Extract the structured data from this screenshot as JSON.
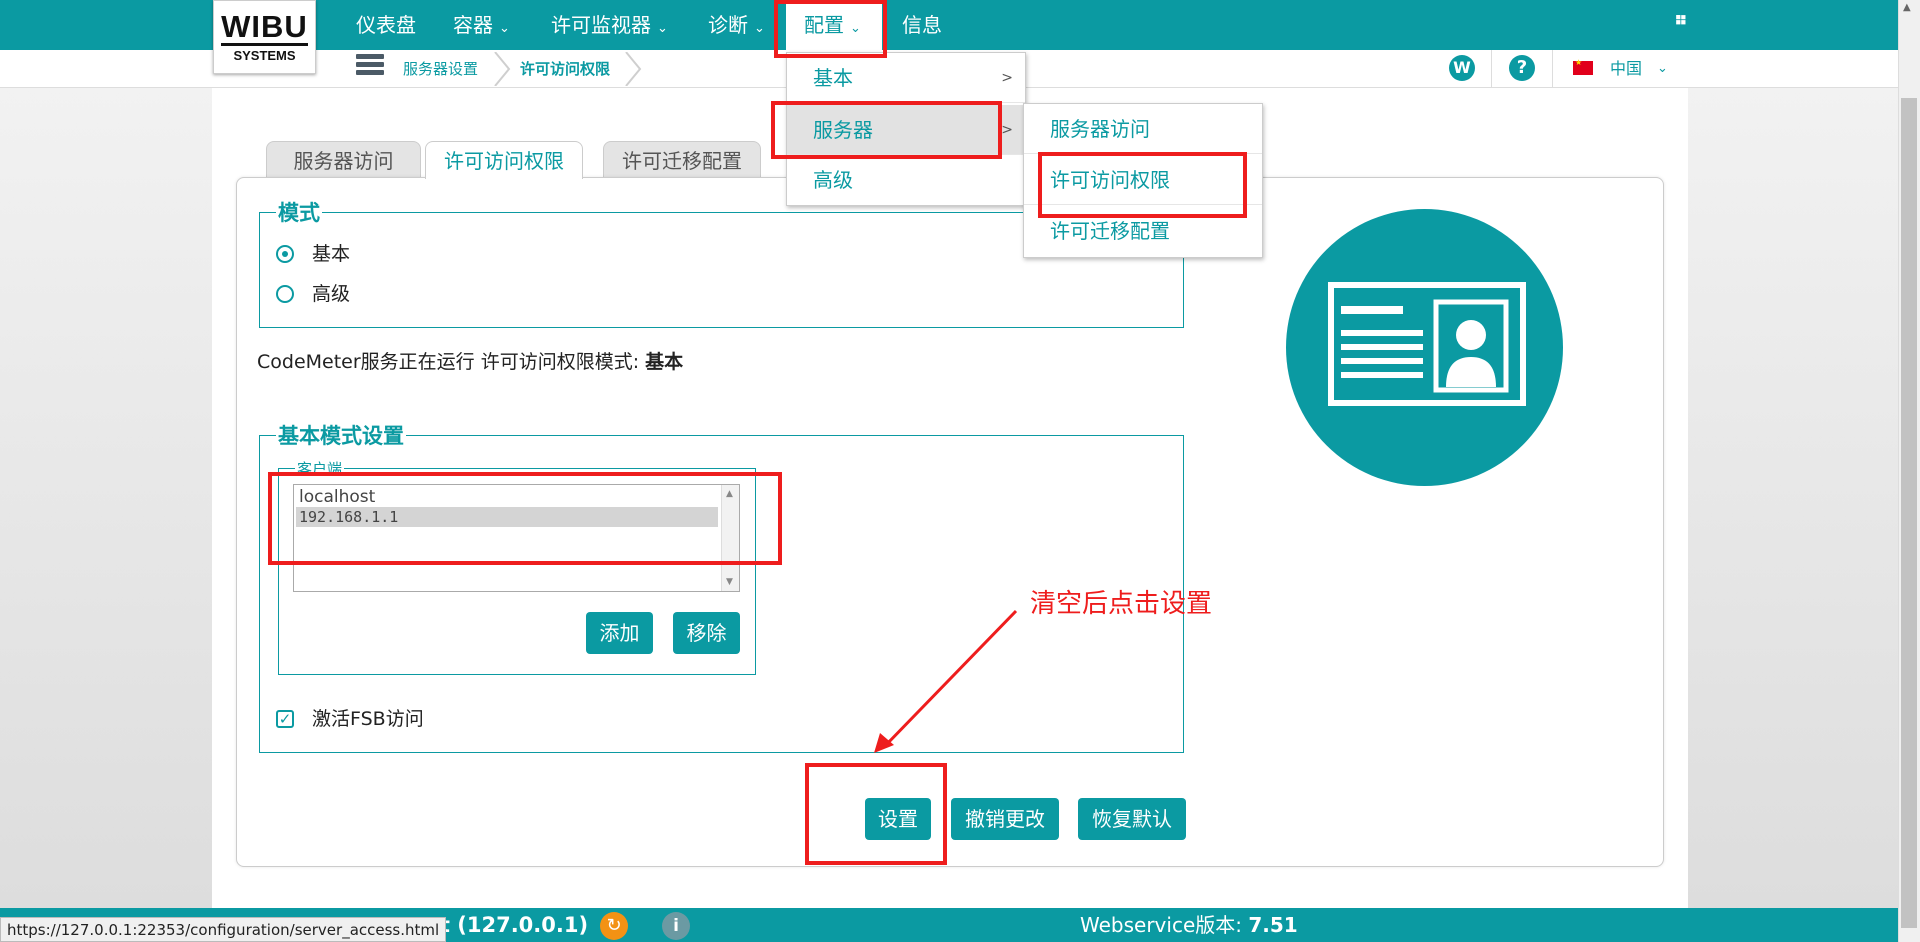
{
  "nav": {
    "logo_top": "WIBU",
    "logo_bottom": "SYSTEMS",
    "items": [
      "仪表盘",
      "容器",
      "许可监视器",
      "诊断",
      "配置",
      "信息"
    ],
    "chevron": "⌄",
    "pin_icon": "📌"
  },
  "breadcrumb": [
    "服务器设置",
    "许可访问权限"
  ],
  "header_right": {
    "w_icon": "W",
    "help_icon": "?",
    "language": "中国",
    "lang_chevron": "⌄"
  },
  "tabs": [
    "服务器访问",
    "许可访问权限",
    "许可迁移配置"
  ],
  "mode": {
    "legend": "模式",
    "options": [
      "基本",
      "高级"
    ],
    "selected": "基本"
  },
  "status_line": {
    "prefix": "CodeMeter服务正在运行 许可访问权限模式: ",
    "value": "基本"
  },
  "basic_settings": {
    "legend": "基本模式设置",
    "client_legend": "客户端",
    "clients": [
      "localhost",
      "192.168.1.1"
    ],
    "selected_client": "192.168.1.1",
    "add_label": "添加",
    "remove_label": "移除",
    "fsb_label": "激活FSB访问",
    "fsb_checked": true
  },
  "actions": {
    "set_label": "设置",
    "revert_label": "撤销更改",
    "default_label": "恢复默认"
  },
  "config_menu": {
    "items": [
      "基本",
      "服务器",
      "高级"
    ],
    "highlighted": "服务器",
    "submenu": [
      "服务器访问",
      "许可访问权限",
      "许可迁移配置"
    ]
  },
  "annotation": {
    "note": "清空后点击设置",
    "color": "#ee1d1d"
  },
  "statusbar": {
    "url_tooltip": "https://127.0.0.1:22353/configuration/server_access.html",
    "host_visible": "ost (127.0.0.1)",
    "webservice_label": "Webservice版本: ",
    "webservice_version": "7.51"
  },
  "colors": {
    "accent": "#0b9aa2",
    "annotation": "#ee1d1d",
    "refresh_icon": "#f39214"
  }
}
